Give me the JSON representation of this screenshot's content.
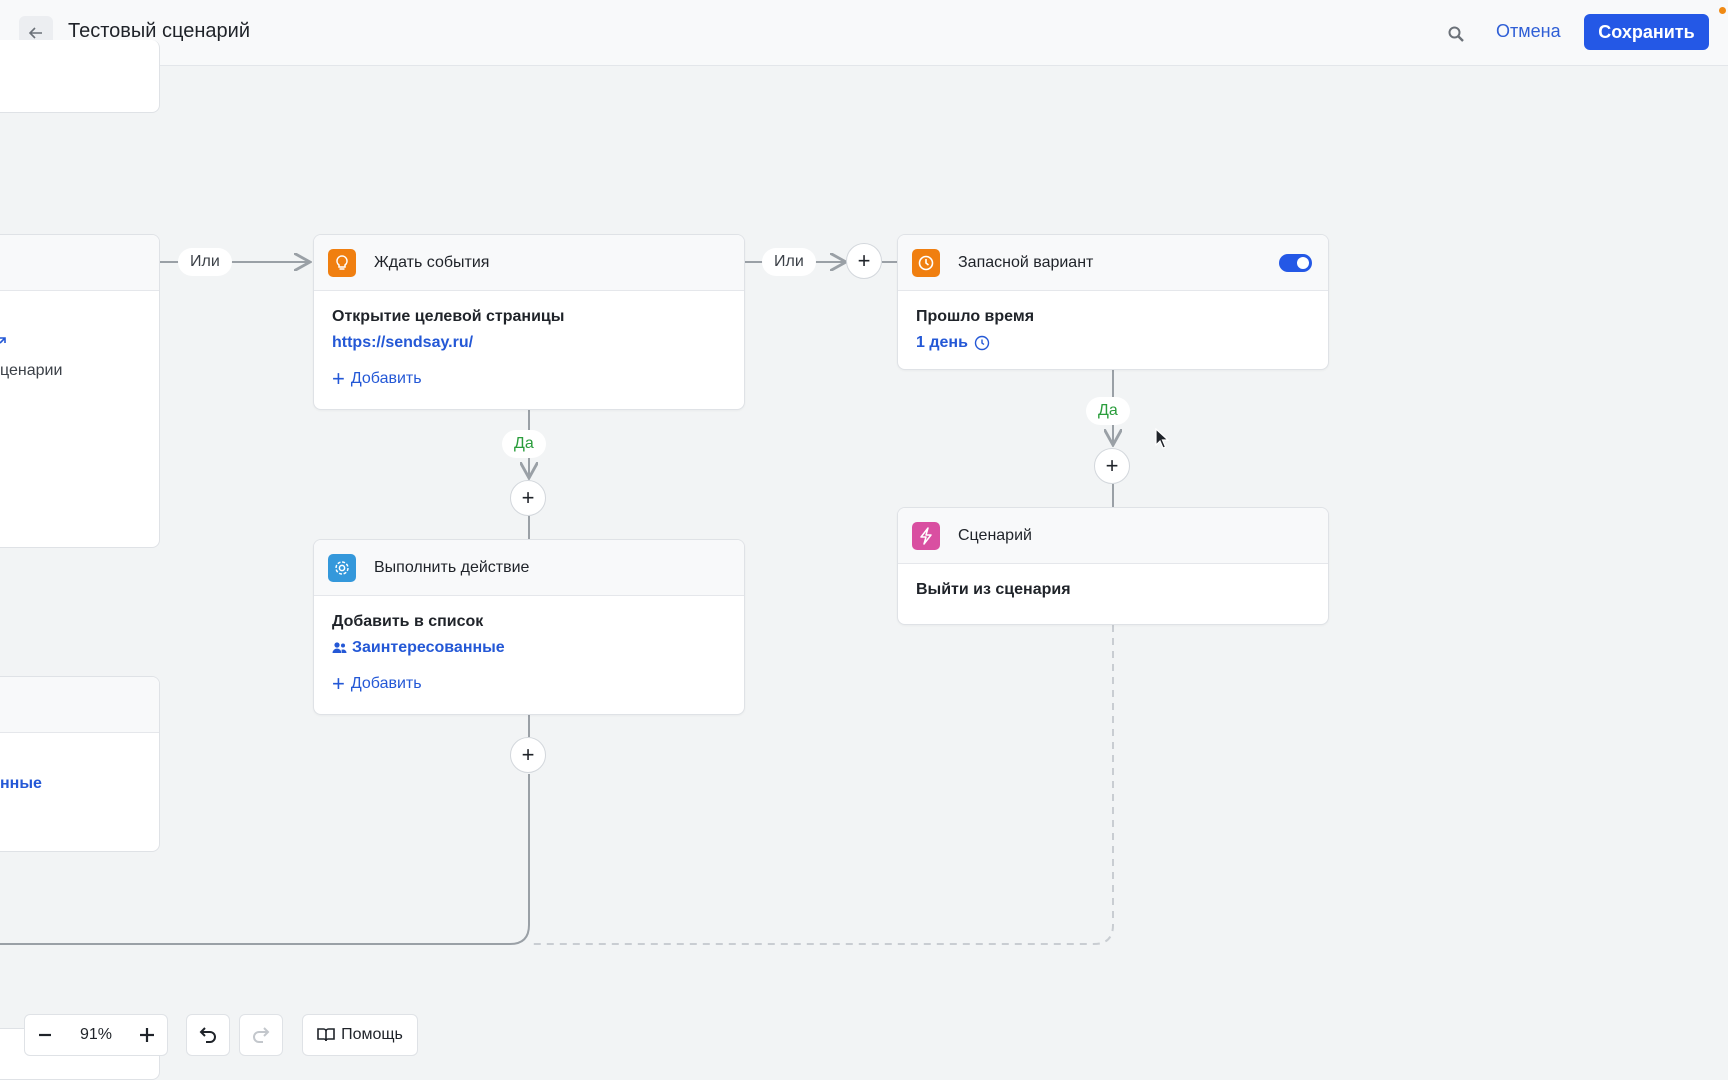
{
  "header": {
    "title": "Тестовый сценарий",
    "cancel_label": "Отмена",
    "save_label": "Сохранить",
    "back_icon": "arrow-left-icon",
    "search_icon": "search-icon"
  },
  "connectors": {
    "or_label": "Или",
    "yes_label": "Да"
  },
  "nodes": {
    "wait_event": {
      "title": "Ждать события",
      "icon": "lightbulb-icon",
      "icon_color": "#f07f10",
      "subtitle": "Открытие целевой страницы",
      "link": "https://sendsay.ru/",
      "add_label": "Добавить"
    },
    "fallback": {
      "title": "Запасной вариант",
      "icon": "clock-icon",
      "icon_color": "#f07f10",
      "subtitle": "Прошло время",
      "duration": "1 день",
      "toggle_on": true
    },
    "do_action": {
      "title": "Выполнить действие",
      "icon": "gear-icon",
      "icon_color": "#3498db",
      "subtitle": "Добавить в список",
      "list_name": "Заинтересованные",
      "add_label": "Добавить"
    },
    "scenario": {
      "title": "Сценарий",
      "icon": "lightning-icon",
      "icon_color": "#d94fa1",
      "subtitle": "Выйти из сценария"
    }
  },
  "partial_left": {
    "text_fragment": "ценарии",
    "link_fragment": "нные"
  },
  "toolbar": {
    "zoom_value": "91%",
    "help_label": "Помощь"
  },
  "colors": {
    "accent": "#2458e6",
    "yes_green": "#2a9d3c",
    "canvas_bg": "#f2f4f5"
  }
}
